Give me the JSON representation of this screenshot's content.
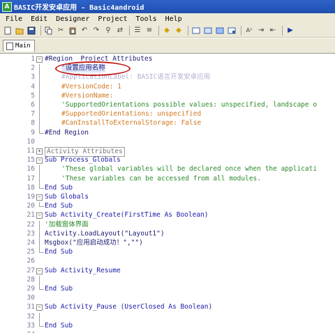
{
  "window": {
    "title": "BASIC开发安卓应用 - Basic4android"
  },
  "menu": [
    "File",
    "Edit",
    "Designer",
    "Project",
    "Tools",
    "Help"
  ],
  "toolbar": {
    "buttons": [
      "new-icon",
      "open-icon",
      "save-icon",
      "sep",
      "copy-icon",
      "cut-icon",
      "paste-icon",
      "undo-icon",
      "redo-icon",
      "find-icon",
      "replace-icon",
      "sep",
      "block-comment-icon",
      "block-uncomment-icon",
      "sep",
      "bookmark-prev-icon",
      "bookmark-next-icon",
      "sep",
      "panel1-icon",
      "panel2-icon",
      "panel3-icon",
      "panel4-icon",
      "sep",
      "font-size-icon",
      "indent-icon",
      "outdent-icon",
      "sep",
      "run-icon"
    ]
  },
  "tabs": [
    {
      "label": "Main"
    }
  ],
  "code_lines": [
    {
      "n": "1",
      "text": "#Region  Project Attributes",
      "fold": "minus"
    },
    {
      "n": "2",
      "text": "'设置应用名称",
      "fold": ""
    },
    {
      "n": "3",
      "text": "#ApplicationLabel: BASIC语言开发安卓应用",
      "fold": ""
    },
    {
      "n": "4",
      "text": "#VersionCode: 1",
      "fold": ""
    },
    {
      "n": "5",
      "text": "#VersionName:",
      "fold": ""
    },
    {
      "n": "6",
      "text": "'SupportedOrientations possible values: unspecified, landscape o",
      "fold": ""
    },
    {
      "n": "7",
      "text": "#SupportedOrientations: unspecified",
      "fold": ""
    },
    {
      "n": "8",
      "text": "#CanInstallToExternalStorage: False",
      "fold": ""
    },
    {
      "n": "9",
      "text": "#End Region",
      "fold": "end"
    },
    {
      "n": "10",
      "text": "",
      "fold": ""
    },
    {
      "n": "11",
      "text": "Activity Attributes",
      "fold": "plus"
    },
    {
      "n": "15",
      "text": "Sub Process_Globals",
      "fold": "minus"
    },
    {
      "n": "16",
      "text": "'These global variables will be declared once when the applicati",
      "fold": ""
    },
    {
      "n": "17",
      "text": "'These variables can be accessed from all modules.",
      "fold": ""
    },
    {
      "n": "18",
      "text": "End Sub",
      "fold": "end"
    },
    {
      "n": "19",
      "text": "Sub Globals",
      "fold": "minus"
    },
    {
      "n": "20",
      "text": "End Sub",
      "fold": "end"
    },
    {
      "n": "21",
      "text": "Sub Activity_Create(FirstTime As Boolean)",
      "fold": "minus"
    },
    {
      "n": "22",
      "text": "'加载窗体界面",
      "fold": ""
    },
    {
      "n": "23",
      "text": "Activity.LoadLayout(\"Layout1\")",
      "fold": ""
    },
    {
      "n": "24",
      "text": "Msgbox(\"应用启动成功！\",\"\")",
      "fold": ""
    },
    {
      "n": "25",
      "text": "End Sub",
      "fold": "end"
    },
    {
      "n": "26",
      "text": "",
      "fold": ""
    },
    {
      "n": "27",
      "text": "Sub Activity_Resume",
      "fold": "minus"
    },
    {
      "n": "28",
      "text": "",
      "fold": ""
    },
    {
      "n": "29",
      "text": "End Sub",
      "fold": "end"
    },
    {
      "n": "30",
      "text": "",
      "fold": ""
    },
    {
      "n": "31",
      "text": "Sub Activity_Pause (UserClosed As Boolean)",
      "fold": "minus"
    },
    {
      "n": "32",
      "text": "",
      "fold": ""
    },
    {
      "n": "33",
      "text": "End Sub",
      "fold": "end"
    },
    {
      "n": "34",
      "text": "",
      "fold": ""
    }
  ],
  "colors": {
    "keyword": "#1a1aa6",
    "comment": "#2a8a2a",
    "directive": "#d2781e",
    "string": "#a31515",
    "annotation_oval": "#c21a1a"
  }
}
